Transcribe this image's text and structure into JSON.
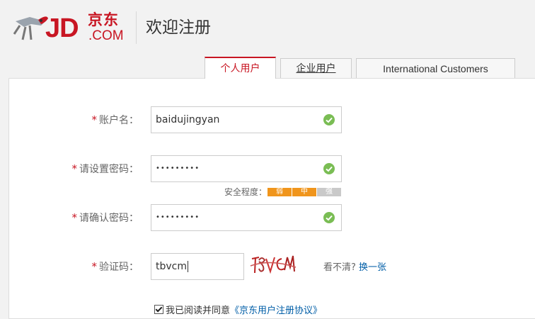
{
  "header": {
    "logo_text": "JD",
    "logo_cn": "京东",
    "logo_com": ".COM",
    "title": "欢迎注册",
    "brand_color": "#c81623"
  },
  "tabs": [
    {
      "label": "个人用户",
      "active": true
    },
    {
      "label": "企业用户",
      "active": false
    },
    {
      "label": "International Customers",
      "active": false
    }
  ],
  "form": {
    "username": {
      "label": "账户名：",
      "value": "baidujingyan",
      "status": "valid"
    },
    "password": {
      "label": "请设置密码：",
      "value": "•••••••••",
      "status": "valid"
    },
    "strength": {
      "label": "安全程度：",
      "levels": [
        "弱",
        "中",
        "强"
      ],
      "current_level": 2
    },
    "confirm": {
      "label": "请确认密码：",
      "value": "•••••••••",
      "status": "valid"
    },
    "captcha": {
      "label": "验证码：",
      "value": "tbvcm",
      "image_text": "TBVCM",
      "help_text": "看不清?",
      "refresh_link": "换一张"
    },
    "required_mark": "*",
    "agreement": {
      "prefix": "我已阅读并同意",
      "link": "《京东用户注册协议》",
      "checked": true
    }
  }
}
